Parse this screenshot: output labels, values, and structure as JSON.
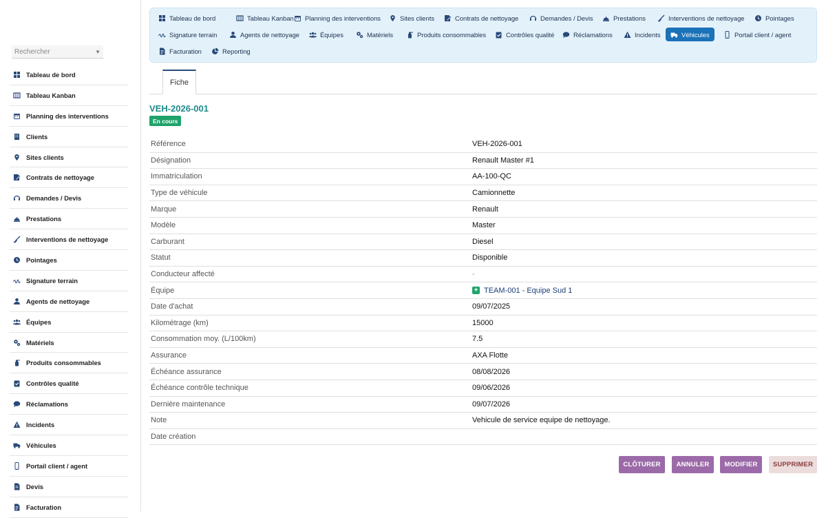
{
  "sidebar": {
    "search_placeholder": "Rechercher",
    "items": [
      {
        "label": "Tableau de bord",
        "icon": "dashboard-icon"
      },
      {
        "label": "Tableau Kanban",
        "icon": "kanban-icon"
      },
      {
        "label": "Planning des interventions",
        "icon": "calendar-icon"
      },
      {
        "label": "Clients",
        "icon": "building-icon"
      },
      {
        "label": "Sites clients",
        "icon": "map-pin-icon"
      },
      {
        "label": "Contrats de nettoyage",
        "icon": "contract-icon"
      },
      {
        "label": "Demandes / Devis",
        "icon": "headset-icon"
      },
      {
        "label": "Prestations",
        "icon": "service-bell-icon"
      },
      {
        "label": "Interventions de nettoyage",
        "icon": "broom-icon"
      },
      {
        "label": "Pointages",
        "icon": "clock-icon"
      },
      {
        "label": "Signature terrain",
        "icon": "signature-icon"
      },
      {
        "label": "Agents de nettoyage",
        "icon": "user-icon"
      },
      {
        "label": "Équipes",
        "icon": "users-icon"
      },
      {
        "label": "Matériels",
        "icon": "gears-icon"
      },
      {
        "label": "Produits consommables",
        "icon": "spray-bottle-icon"
      },
      {
        "label": "Contrôles qualité",
        "icon": "clipboard-check-icon"
      },
      {
        "label": "Réclamations",
        "icon": "comment-icon"
      },
      {
        "label": "Incidents",
        "icon": "warning-icon"
      },
      {
        "label": "Véhicules",
        "icon": "truck-icon"
      },
      {
        "label": "Portail client / agent",
        "icon": "mobile-icon"
      },
      {
        "label": "Devis",
        "icon": "document-icon"
      },
      {
        "label": "Facturation",
        "icon": "invoice-icon"
      }
    ]
  },
  "topnav": {
    "items": [
      {
        "label": "Tableau de bord",
        "icon": "dashboard-icon"
      },
      {
        "label": "Tableau Kanban",
        "icon": "kanban-icon"
      },
      {
        "label": "Planning des interventions",
        "icon": "calendar-icon"
      },
      {
        "label": "Sites clients",
        "icon": "map-pin-icon"
      },
      {
        "label": "Contrats de nettoyage",
        "icon": "contract-icon"
      },
      {
        "label": "Demandes / Devis",
        "icon": "headset-icon"
      },
      {
        "label": "Prestations",
        "icon": "service-bell-icon"
      },
      {
        "label": "Interventions de nettoyage",
        "icon": "broom-icon"
      },
      {
        "label": "Pointages",
        "icon": "clock-icon"
      },
      {
        "label": "Signature terrain",
        "icon": "signature-icon"
      },
      {
        "label": "Agents de nettoyage",
        "icon": "user-icon"
      },
      {
        "label": "Équipes",
        "icon": "users-icon"
      },
      {
        "label": "Matériels",
        "icon": "gears-icon"
      },
      {
        "label": "Produits consommables",
        "icon": "spray-bottle-icon"
      },
      {
        "label": "Contrôles qualité",
        "icon": "clipboard-check-icon"
      },
      {
        "label": "Réclamations",
        "icon": "comment-icon"
      },
      {
        "label": "Incidents",
        "icon": "warning-icon"
      },
      {
        "label": "Véhicules",
        "icon": "truck-icon",
        "active": true
      },
      {
        "label": "Portail client / agent",
        "icon": "mobile-icon"
      },
      {
        "label": "Facturation",
        "icon": "invoice-icon"
      },
      {
        "label": "Reporting",
        "icon": "pie-chart-icon"
      }
    ]
  },
  "tabs": {
    "fiche": "Fiche"
  },
  "record": {
    "title": "VEH-2026-001",
    "status_badge": "En cours",
    "fields": [
      {
        "label": "Référence",
        "value": "VEH-2026-001"
      },
      {
        "label": "Désignation",
        "value": "Renault Master #1"
      },
      {
        "label": "Immatriculation",
        "value": "AA-100-QC"
      },
      {
        "label": "Type de véhicule",
        "value": "Camionnette"
      },
      {
        "label": "Marque",
        "value": "Renault"
      },
      {
        "label": "Modèle",
        "value": "Master"
      },
      {
        "label": "Carburant",
        "value": "Diesel"
      },
      {
        "label": "Statut",
        "value": "Disponible"
      },
      {
        "label": "Conducteur affecté",
        "value": "-"
      },
      {
        "label": "Équipe",
        "value": "TEAM-001 - Equipe Sud 1",
        "link": true
      },
      {
        "label": "Date d'achat",
        "value": "09/07/2025"
      },
      {
        "label": "Kilométrage (km)",
        "value": "15000"
      },
      {
        "label": "Consommation moy. (L/100km)",
        "value": "7.5"
      },
      {
        "label": "Assurance",
        "value": "AXA Flotte"
      },
      {
        "label": "Échéance assurance",
        "value": "08/08/2026"
      },
      {
        "label": "Échéance contrôle technique",
        "value": "09/06/2026"
      },
      {
        "label": "Dernière maintenance",
        "value": "09/07/2026"
      },
      {
        "label": "Note",
        "value": "Vehicule de service equipe de nettoyage."
      },
      {
        "label": "Date création",
        "value": ""
      }
    ]
  },
  "actions": {
    "cloturer": "CLÔTURER",
    "annuler": "ANNULER",
    "modifier": "MODIFIER",
    "supprimer": "SUPPRIMER"
  },
  "colors": {
    "accent": "#1a72b8",
    "title": "#1e8a8a",
    "badge": "#1fa36b",
    "action_button": "#9c6aa8"
  }
}
